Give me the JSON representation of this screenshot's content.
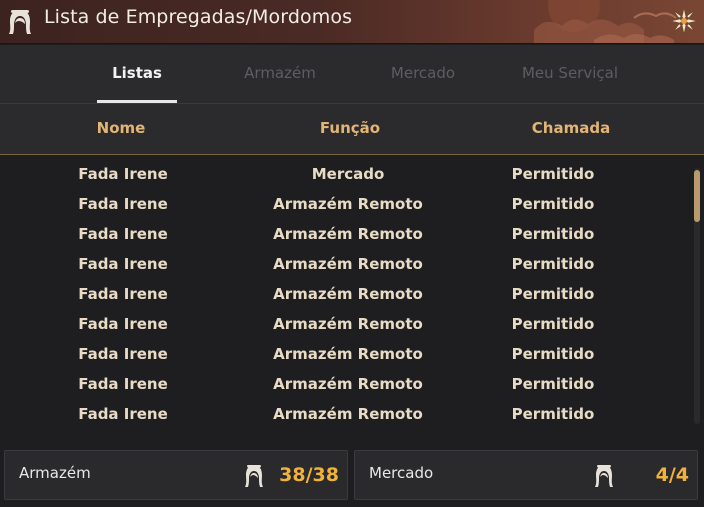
{
  "window": {
    "title": "Lista de Empregadas/Mordomos",
    "title_icon": "maid-icon",
    "close_icon": "close-ornament-icon"
  },
  "tabs": [
    {
      "label": "Listas",
      "active": true
    },
    {
      "label": "Armazém",
      "active": false
    },
    {
      "label": "Mercado",
      "active": false
    },
    {
      "label": "Meu Serviçal",
      "active": false
    }
  ],
  "table": {
    "headers": [
      "Nome",
      "Função",
      "Chamada"
    ],
    "rows": [
      [
        "Fada Irene",
        "Mercado",
        "Permitido"
      ],
      [
        "Fada Irene",
        "Armazém Remoto",
        "Permitido"
      ],
      [
        "Fada Irene",
        "Armazém Remoto",
        "Permitido"
      ],
      [
        "Fada Irene",
        "Armazém Remoto",
        "Permitido"
      ],
      [
        "Fada Irene",
        "Armazém Remoto",
        "Permitido"
      ],
      [
        "Fada Irene",
        "Armazém Remoto",
        "Permitido"
      ],
      [
        "Fada Irene",
        "Armazém Remoto",
        "Permitido"
      ],
      [
        "Fada Irene",
        "Armazém Remoto",
        "Permitido"
      ],
      [
        "Fada Irene",
        "Armazém Remoto",
        "Permitido"
      ]
    ]
  },
  "footer": {
    "storage": {
      "label": "Armazém",
      "count": "38/38",
      "icon": "maid-icon"
    },
    "market": {
      "label": "Mercado",
      "count": "4/4",
      "icon": "maid-icon"
    }
  },
  "colors": {
    "accent": "#f0b23c",
    "header_text": "#e2b476",
    "row_text": "#e8dcc6",
    "titlebar": "#4a2a24"
  }
}
